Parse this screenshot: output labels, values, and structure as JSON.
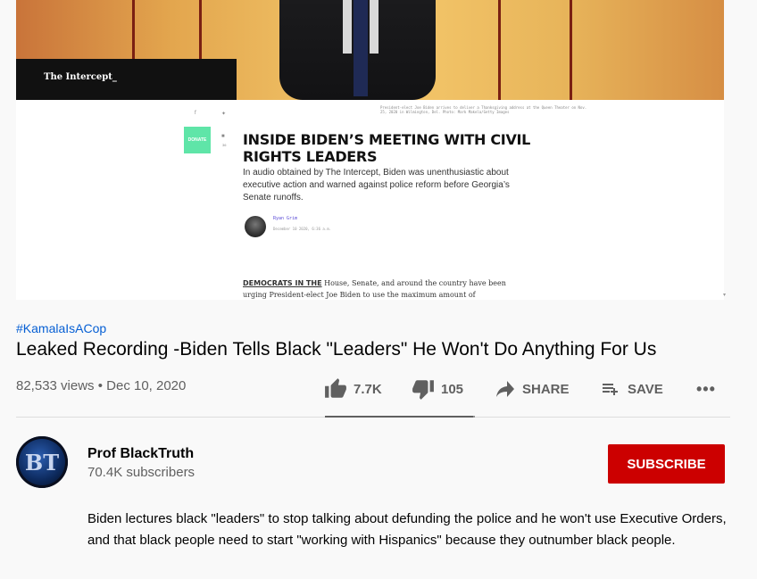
{
  "video": {
    "logo_text": "The Intercept_",
    "photo_caption": "President-elect Joe Biden arrives to deliver a Thanksgiving address at the Queen Theater on Nov. 25, 2020 in Wilmington, Del. Photo: Mark Makela/Getty Images",
    "donate_label": "DONATE",
    "comment_count": "36",
    "article_title": "INSIDE BIDEN’S MEETING WITH CIVIL RIGHTS LEADERS",
    "article_dek": "In audio obtained by The Intercept, Biden was unenthusiastic about executive action and warned against police reform before Georgia’s Senate runoffs.",
    "byline_name": "Ryan Grim",
    "byline_date": "December 10 2020, 6:36 a.m.",
    "lede_lead": "DEMOCRATS IN THE",
    "lede_rest": " House, Senate, and around the country have been urging President-elect Joe Biden to use the maximum amount of executive"
  },
  "hashtag": "#KamalaIsACop",
  "title": "Leaked Recording -Biden Tells Black \"Leaders\" He Won't Do Anything For Us",
  "views_date": "82,533 views • Dec 10, 2020",
  "actions": {
    "likes": "7.7K",
    "dislikes": "105",
    "share": "SHARE",
    "save": "SAVE",
    "like_ratio": 0.986
  },
  "channel": {
    "avatar_text": "BT",
    "name": "Prof BlackTruth",
    "subscribers": "70.4K subscribers",
    "subscribe_label": "SUBSCRIBE"
  },
  "description": "Biden lectures black \"leaders\" to stop talking about defunding the police and he won't use Executive Orders, and that black people need to start \"working with Hispanics\" because they outnumber black people.",
  "colors": {
    "subscribe": "#cc0000",
    "hashtag": "#065fd4",
    "donate": "#5fe5a8"
  }
}
